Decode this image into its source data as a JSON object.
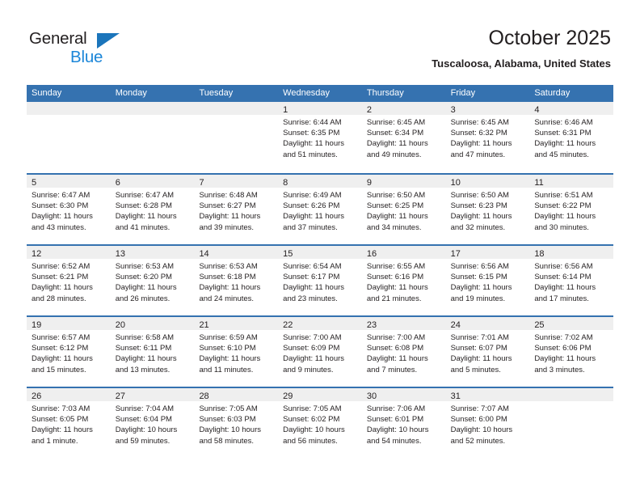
{
  "brand": {
    "name_dark": "General",
    "name_light": "Blue"
  },
  "header": {
    "title": "October 2025",
    "subtitle": "Tuscaloosa, Alabama, United States"
  },
  "colors": {
    "header_blue": "#3572b0",
    "brand_blue": "#1b86d8",
    "triangle_blue": "#1b75bb",
    "daynum_band": "#efefef",
    "text": "#231f20"
  },
  "weekdays": [
    "Sunday",
    "Monday",
    "Tuesday",
    "Wednesday",
    "Thursday",
    "Friday",
    "Saturday"
  ],
  "weeks": [
    [
      {
        "day": "",
        "lines": [
          "",
          "",
          "",
          ""
        ]
      },
      {
        "day": "",
        "lines": [
          "",
          "",
          "",
          ""
        ]
      },
      {
        "day": "",
        "lines": [
          "",
          "",
          "",
          ""
        ]
      },
      {
        "day": "1",
        "lines": [
          "Sunrise: 6:44 AM",
          "Sunset: 6:35 PM",
          "Daylight: 11 hours",
          "and 51 minutes."
        ]
      },
      {
        "day": "2",
        "lines": [
          "Sunrise: 6:45 AM",
          "Sunset: 6:34 PM",
          "Daylight: 11 hours",
          "and 49 minutes."
        ]
      },
      {
        "day": "3",
        "lines": [
          "Sunrise: 6:45 AM",
          "Sunset: 6:32 PM",
          "Daylight: 11 hours",
          "and 47 minutes."
        ]
      },
      {
        "day": "4",
        "lines": [
          "Sunrise: 6:46 AM",
          "Sunset: 6:31 PM",
          "Daylight: 11 hours",
          "and 45 minutes."
        ]
      }
    ],
    [
      {
        "day": "5",
        "lines": [
          "Sunrise: 6:47 AM",
          "Sunset: 6:30 PM",
          "Daylight: 11 hours",
          "and 43 minutes."
        ]
      },
      {
        "day": "6",
        "lines": [
          "Sunrise: 6:47 AM",
          "Sunset: 6:28 PM",
          "Daylight: 11 hours",
          "and 41 minutes."
        ]
      },
      {
        "day": "7",
        "lines": [
          "Sunrise: 6:48 AM",
          "Sunset: 6:27 PM",
          "Daylight: 11 hours",
          "and 39 minutes."
        ]
      },
      {
        "day": "8",
        "lines": [
          "Sunrise: 6:49 AM",
          "Sunset: 6:26 PM",
          "Daylight: 11 hours",
          "and 37 minutes."
        ]
      },
      {
        "day": "9",
        "lines": [
          "Sunrise: 6:50 AM",
          "Sunset: 6:25 PM",
          "Daylight: 11 hours",
          "and 34 minutes."
        ]
      },
      {
        "day": "10",
        "lines": [
          "Sunrise: 6:50 AM",
          "Sunset: 6:23 PM",
          "Daylight: 11 hours",
          "and 32 minutes."
        ]
      },
      {
        "day": "11",
        "lines": [
          "Sunrise: 6:51 AM",
          "Sunset: 6:22 PM",
          "Daylight: 11 hours",
          "and 30 minutes."
        ]
      }
    ],
    [
      {
        "day": "12",
        "lines": [
          "Sunrise: 6:52 AM",
          "Sunset: 6:21 PM",
          "Daylight: 11 hours",
          "and 28 minutes."
        ]
      },
      {
        "day": "13",
        "lines": [
          "Sunrise: 6:53 AM",
          "Sunset: 6:20 PM",
          "Daylight: 11 hours",
          "and 26 minutes."
        ]
      },
      {
        "day": "14",
        "lines": [
          "Sunrise: 6:53 AM",
          "Sunset: 6:18 PM",
          "Daylight: 11 hours",
          "and 24 minutes."
        ]
      },
      {
        "day": "15",
        "lines": [
          "Sunrise: 6:54 AM",
          "Sunset: 6:17 PM",
          "Daylight: 11 hours",
          "and 23 minutes."
        ]
      },
      {
        "day": "16",
        "lines": [
          "Sunrise: 6:55 AM",
          "Sunset: 6:16 PM",
          "Daylight: 11 hours",
          "and 21 minutes."
        ]
      },
      {
        "day": "17",
        "lines": [
          "Sunrise: 6:56 AM",
          "Sunset: 6:15 PM",
          "Daylight: 11 hours",
          "and 19 minutes."
        ]
      },
      {
        "day": "18",
        "lines": [
          "Sunrise: 6:56 AM",
          "Sunset: 6:14 PM",
          "Daylight: 11 hours",
          "and 17 minutes."
        ]
      }
    ],
    [
      {
        "day": "19",
        "lines": [
          "Sunrise: 6:57 AM",
          "Sunset: 6:12 PM",
          "Daylight: 11 hours",
          "and 15 minutes."
        ]
      },
      {
        "day": "20",
        "lines": [
          "Sunrise: 6:58 AM",
          "Sunset: 6:11 PM",
          "Daylight: 11 hours",
          "and 13 minutes."
        ]
      },
      {
        "day": "21",
        "lines": [
          "Sunrise: 6:59 AM",
          "Sunset: 6:10 PM",
          "Daylight: 11 hours",
          "and 11 minutes."
        ]
      },
      {
        "day": "22",
        "lines": [
          "Sunrise: 7:00 AM",
          "Sunset: 6:09 PM",
          "Daylight: 11 hours",
          "and 9 minutes."
        ]
      },
      {
        "day": "23",
        "lines": [
          "Sunrise: 7:00 AM",
          "Sunset: 6:08 PM",
          "Daylight: 11 hours",
          "and 7 minutes."
        ]
      },
      {
        "day": "24",
        "lines": [
          "Sunrise: 7:01 AM",
          "Sunset: 6:07 PM",
          "Daylight: 11 hours",
          "and 5 minutes."
        ]
      },
      {
        "day": "25",
        "lines": [
          "Sunrise: 7:02 AM",
          "Sunset: 6:06 PM",
          "Daylight: 11 hours",
          "and 3 minutes."
        ]
      }
    ],
    [
      {
        "day": "26",
        "lines": [
          "Sunrise: 7:03 AM",
          "Sunset: 6:05 PM",
          "Daylight: 11 hours",
          "and 1 minute."
        ]
      },
      {
        "day": "27",
        "lines": [
          "Sunrise: 7:04 AM",
          "Sunset: 6:04 PM",
          "Daylight: 10 hours",
          "and 59 minutes."
        ]
      },
      {
        "day": "28",
        "lines": [
          "Sunrise: 7:05 AM",
          "Sunset: 6:03 PM",
          "Daylight: 10 hours",
          "and 58 minutes."
        ]
      },
      {
        "day": "29",
        "lines": [
          "Sunrise: 7:05 AM",
          "Sunset: 6:02 PM",
          "Daylight: 10 hours",
          "and 56 minutes."
        ]
      },
      {
        "day": "30",
        "lines": [
          "Sunrise: 7:06 AM",
          "Sunset: 6:01 PM",
          "Daylight: 10 hours",
          "and 54 minutes."
        ]
      },
      {
        "day": "31",
        "lines": [
          "Sunrise: 7:07 AM",
          "Sunset: 6:00 PM",
          "Daylight: 10 hours",
          "and 52 minutes."
        ]
      },
      {
        "day": "",
        "lines": [
          "",
          "",
          "",
          ""
        ]
      }
    ]
  ]
}
